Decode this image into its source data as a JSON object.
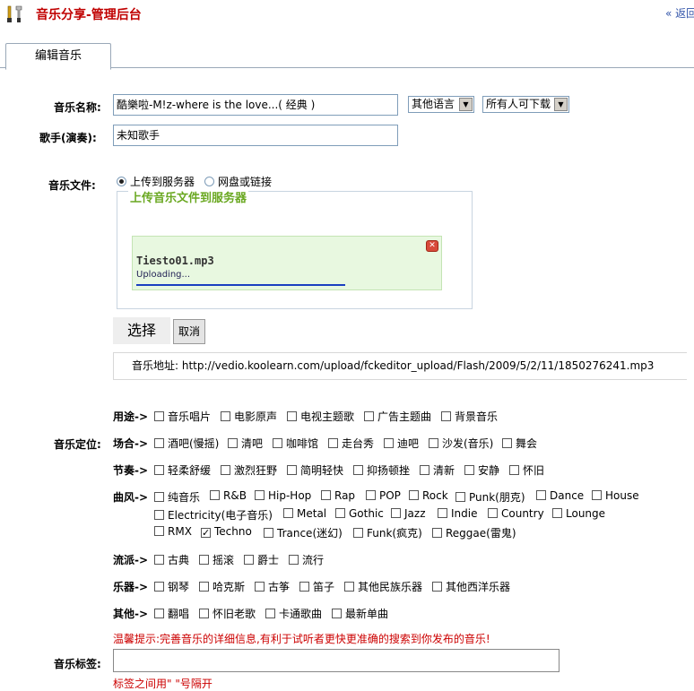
{
  "header": {
    "title": "音乐分享-管理后台",
    "back_link": "« 返回"
  },
  "tab": {
    "label": "编辑音乐"
  },
  "form": {
    "name_label": "音乐名称:",
    "name_value": "酷樂啦-M!z-where is the love...( 经典 )",
    "language_select": "其他语言",
    "download_select": "所有人可下载",
    "singer_label": "歌手(演奏):",
    "singer_value": "未知歌手",
    "file_label": "音乐文件:",
    "radio_upload": "上传到服务器",
    "radio_link": "网盘或链接",
    "upload_legend": "上传音乐文件到服务器",
    "upload_file_name": "Tiesto01.mp3",
    "upload_status": "Uploading...",
    "upload_progress": 0.65,
    "choose_button": "选择",
    "cancel_button": "取消",
    "address_text": "音乐地址: http://vedio.koolearn.com/upload/fckeditor_upload/Flash/2009/5/2/11/1850276241.mp3",
    "position_label": "音乐定位:",
    "tip": "温馨提示:完善音乐的详细信息,有利于试听者更快更准确的搜索到你发布的音乐!",
    "tag_label": "音乐标签:",
    "tag_value": "",
    "tag_hint": "标签之间用\" \"号隔开"
  },
  "groups": {
    "usage": {
      "label": "用途->",
      "options": [
        "音乐唱片",
        "电影原声",
        "电视主题歌",
        "广告主题曲",
        "背景音乐"
      ]
    },
    "occasion": {
      "label": "场合->",
      "options": [
        "酒吧(慢摇)",
        "清吧",
        "咖啡馆",
        "走台秀",
        "迪吧",
        "沙发(音乐)",
        "舞会"
      ]
    },
    "tempo": {
      "label": "节奏->",
      "options": [
        "轻柔舒缓",
        "激烈狂野",
        "简明轻快",
        "抑扬顿挫",
        "清新",
        "安静",
        "怀旧"
      ]
    },
    "style": {
      "label": "曲风->",
      "row1": [
        "纯音乐",
        "R&B",
        "Hip-Hop",
        "Rap",
        "POP",
        "Rock",
        "Punk(朋克)",
        "Dance",
        "House"
      ],
      "row2": [
        "Electricity(电子音乐)",
        "Metal",
        "Gothic",
        "Jazz",
        "Indie",
        "Country",
        "Lounge"
      ],
      "row3": [
        "RMX",
        "Techno",
        "Trance(迷幻)",
        "Funk(疯克)",
        "Reggae(雷鬼)"
      ],
      "checked": "Techno"
    },
    "genre": {
      "label": "流派->",
      "options": [
        "古典",
        "摇滚",
        "爵士",
        "流行"
      ]
    },
    "instrument": {
      "label": "乐器->",
      "options": [
        "钢琴",
        "哈克斯",
        "古筝",
        "笛子",
        "其他民族乐器",
        "其他西洋乐器"
      ]
    },
    "other": {
      "label": "其他->",
      "options": [
        "翻唱",
        "怀旧老歌",
        "卡通歌曲",
        "最新单曲"
      ]
    }
  },
  "colors": {
    "title_red": "#c00000",
    "legend_green": "#6aa821",
    "tip_red": "#cc0000",
    "progress_blue": "#1a3fc0"
  }
}
